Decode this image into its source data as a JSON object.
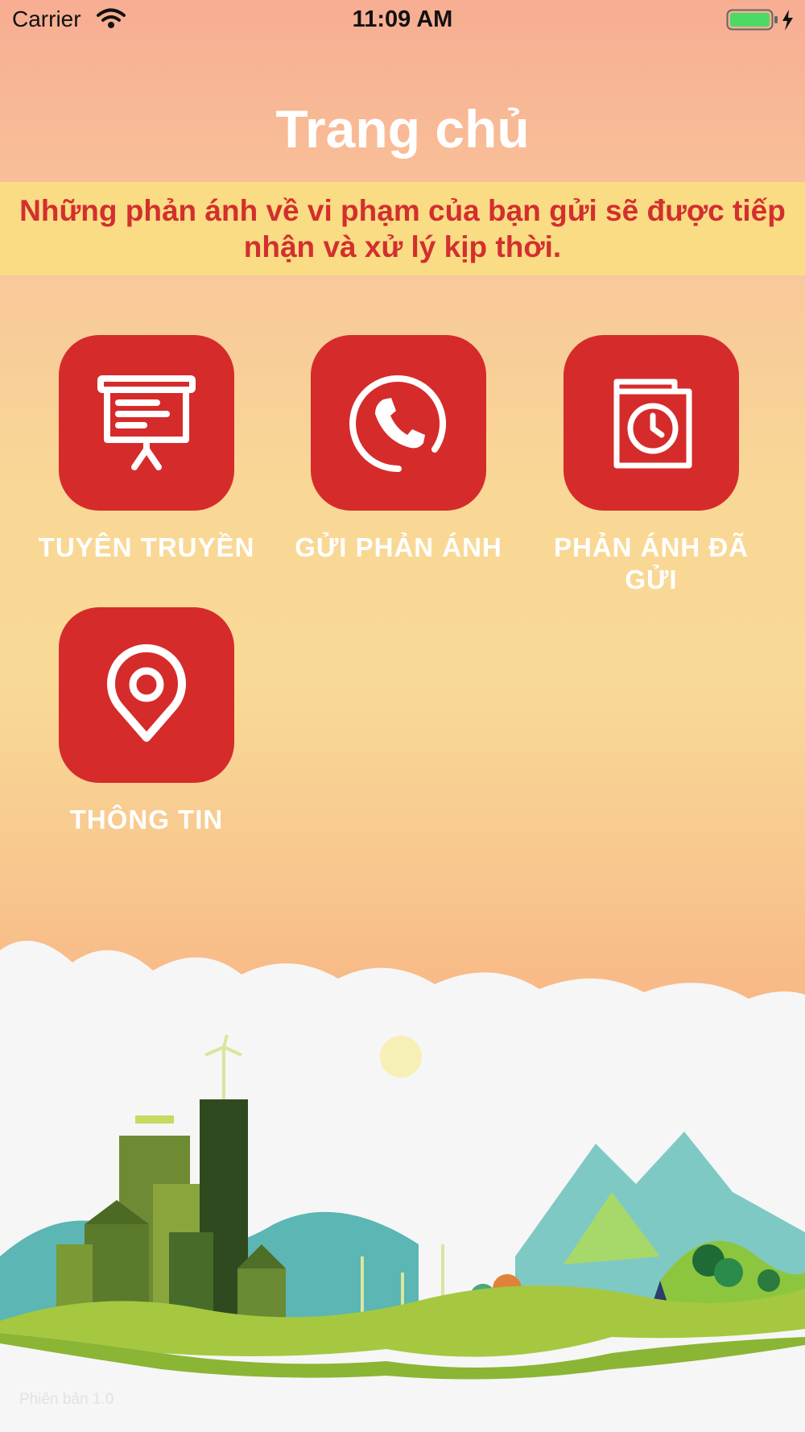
{
  "status_bar": {
    "carrier": "Carrier",
    "time": "11:09 AM"
  },
  "header": {
    "title": "Trang chủ"
  },
  "banner": {
    "text": "Những phản ánh về vi phạm của bạn gửi sẽ được tiếp nhận và xử lý kịp thời."
  },
  "tiles": [
    {
      "label": "TUYÊN TRUYỀN",
      "icon": "presentation-board-icon"
    },
    {
      "label": "GỬI PHẢN ÁNH",
      "icon": "phone-call-icon"
    },
    {
      "label": "PHẢN ÁNH ĐÃ GỬI",
      "icon": "history-book-icon"
    },
    {
      "label": "THÔNG TIN",
      "icon": "location-pin-icon"
    }
  ],
  "footer": {
    "version": "Phiên bản 1.0"
  },
  "colors": {
    "tile": "#d62b2b",
    "banner_bg": "#f9dc84",
    "banner_text": "#d32f2f",
    "title": "#ffffff"
  }
}
